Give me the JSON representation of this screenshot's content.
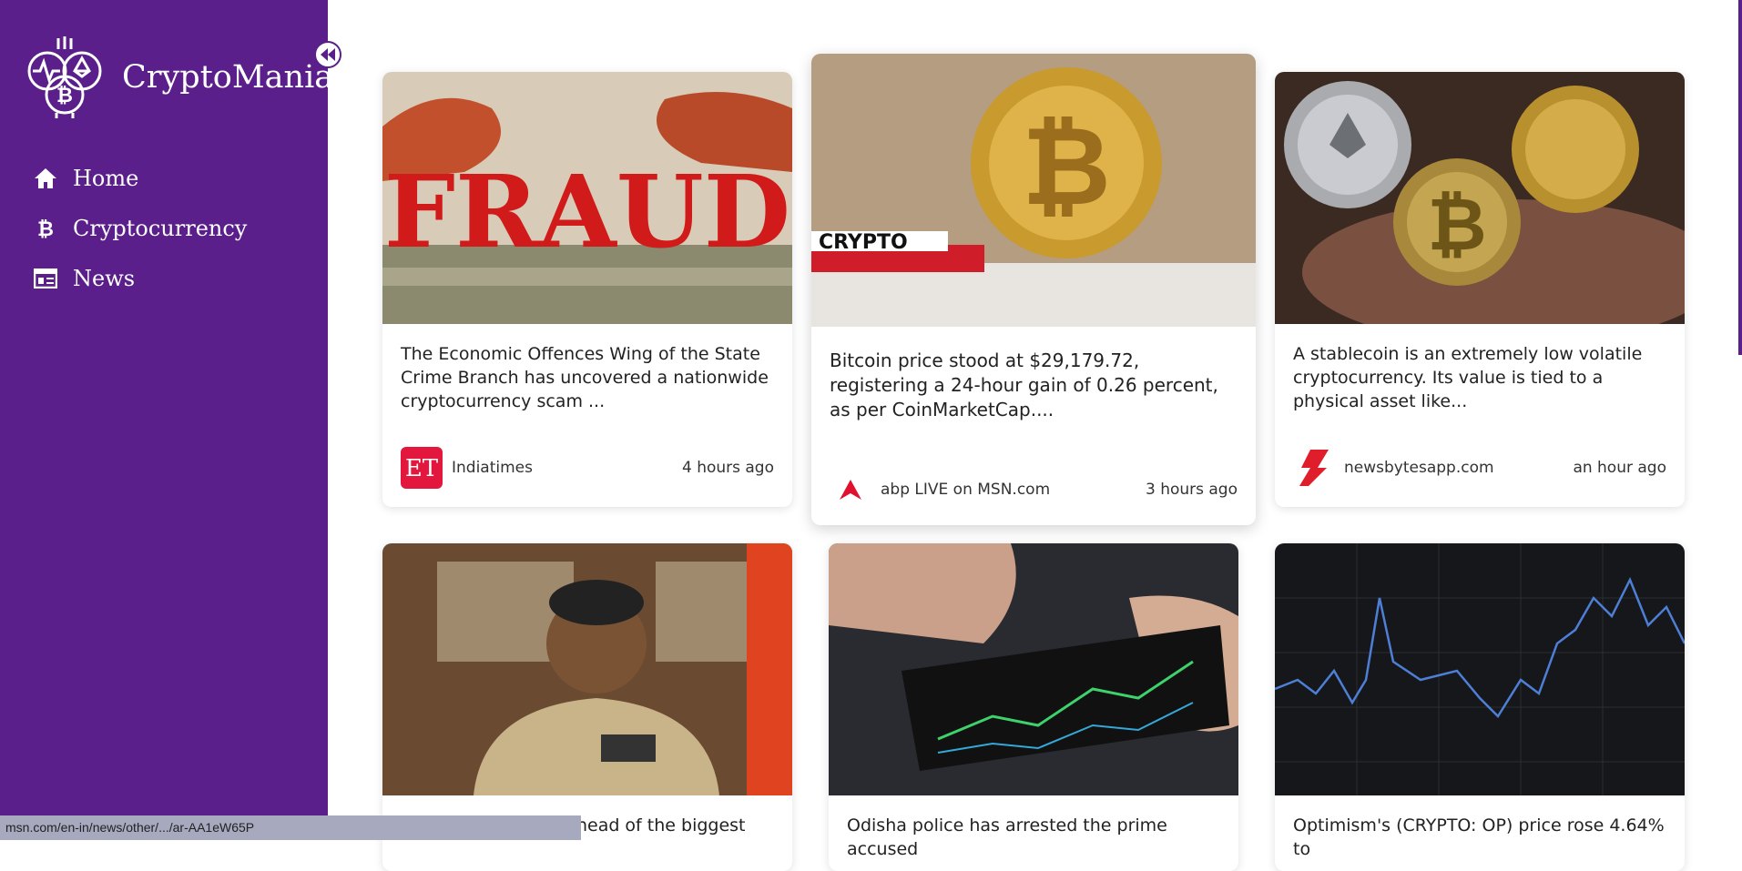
{
  "app": {
    "name": "CryptoMania",
    "accent": "#5a1f8a"
  },
  "sidebar": {
    "items": [
      {
        "label": "Home",
        "icon": "home-icon"
      },
      {
        "label": "Cryptocurrency",
        "icon": "bitcoin-icon"
      },
      {
        "label": "News",
        "icon": "news-icon"
      }
    ]
  },
  "news": [
    {
      "text": "The Economic Offences Wing of the State Crime Branch has uncovered a nationwide cryptocurrency scam ...",
      "source": "Indiatimes",
      "time": "4 hours ago",
      "image": "fraud-image"
    },
    {
      "text": "Bitcoin price stood at $29,179.72, registering a 24-hour gain of 0.26 percent, as per CoinMarketCap....",
      "source": "abp LIVE on MSN.com",
      "time": "3 hours ago",
      "image": "bitcoin-image"
    },
    {
      "text": "A stablecoin is an extremely low volatile cryptocurrency. Its value is tied to a physical asset like...",
      "source": "newsbytesapp.com",
      "time": "an hour ago",
      "image": "coins-hand-image"
    },
    {
      "text": "ia head of the biggest",
      "image": "police-officer-image"
    },
    {
      "text": "Odisha police has arrested the prime accused",
      "image": "phone-trading-image"
    },
    {
      "text": "Optimism's (CRYPTO: OP) price rose 4.64% to",
      "image": "price-chart-image"
    }
  ],
  "status_url": "msn.com/en-in/news/other/.../ar-AA1eW65P"
}
